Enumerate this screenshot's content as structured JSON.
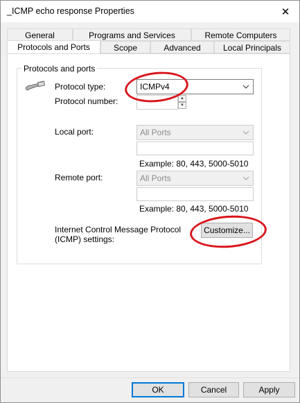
{
  "window": {
    "title": "_ICMP echo response Properties",
    "close_glyph": "✕"
  },
  "tabs_row1": [
    "General",
    "Programs and Services",
    "Remote Computers"
  ],
  "tabs_row2": [
    "Protocols and Ports",
    "Scope",
    "Advanced",
    "Local Principals"
  ],
  "active_tab": "Protocols and Ports",
  "group": {
    "label": "Protocols and ports",
    "protocol_type_label": "Protocol type:",
    "protocol_type_value": "ICMPv4",
    "protocol_number_label": "Protocol number:",
    "protocol_number_value": "",
    "local_port_label": "Local port:",
    "local_port_value": "All Ports",
    "local_port_text": "",
    "local_example": "Example: 80, 443, 5000-5010",
    "remote_port_label": "Remote port:",
    "remote_port_value": "All Ports",
    "remote_port_text": "",
    "remote_example": "Example: 80, 443, 5000-5010",
    "icmp_label_line1": "Internet Control Message Protocol",
    "icmp_label_line2": "(ICMP) settings:",
    "customize_label": "Customize..."
  },
  "footer": {
    "ok": "OK",
    "cancel": "Cancel",
    "apply": "Apply"
  },
  "icons": {
    "protocol_icon": "network-cable-icon",
    "dropdown": "chevron-down-icon",
    "spin_up": "▲",
    "spin_down": "▼",
    "chevron": "⌄"
  },
  "colors": {
    "annotation_red": "#d9161c",
    "accent": "#0078d7"
  }
}
